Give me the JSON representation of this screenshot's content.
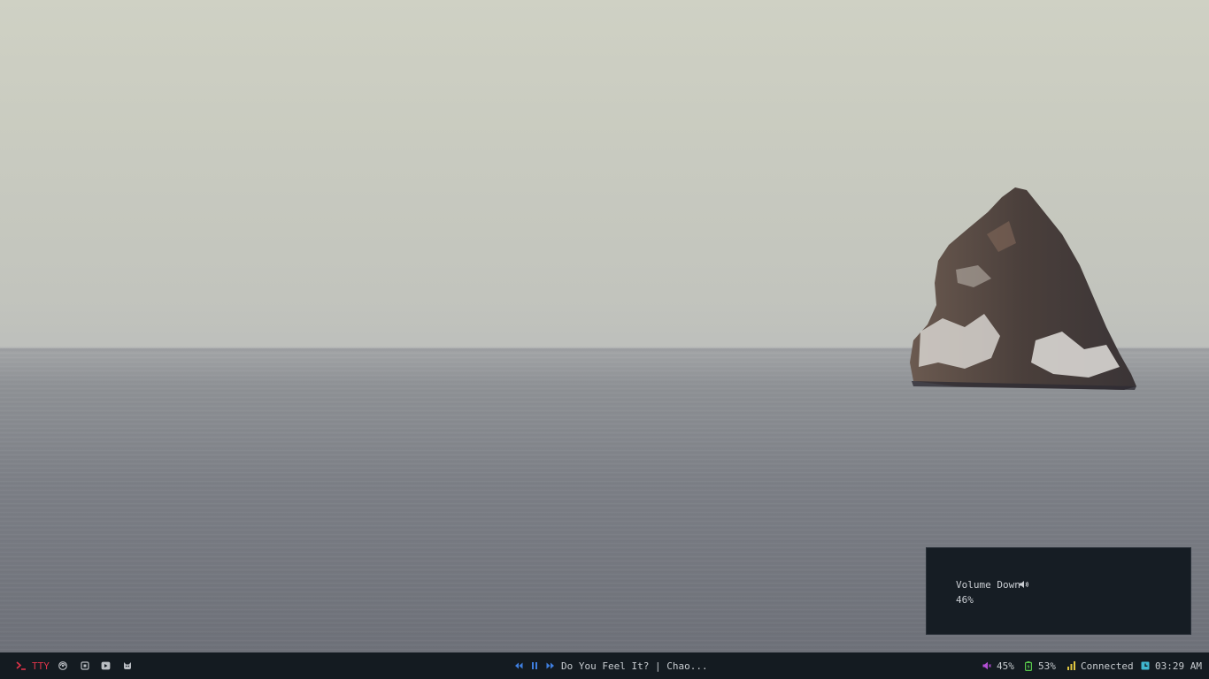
{
  "notification": {
    "title": "Volume Down",
    "value": "46%",
    "icon": "speaker-icon"
  },
  "bar": {
    "left": {
      "tty_icon": "terminal-prompt-icon",
      "tty_label": "TTY",
      "apps": [
        {
          "icon": "browser-icon"
        },
        {
          "icon": "files-icon"
        },
        {
          "icon": "media-player-icon"
        },
        {
          "icon": "cat-icon"
        }
      ]
    },
    "media": {
      "prev_icon": "rewind-icon",
      "play_icon": "pause-icon",
      "next_icon": "fast-forward-icon",
      "track": "Do You Feel It? | Chao..."
    },
    "status": {
      "volume": "45%",
      "battery": "53%",
      "network": "Connected",
      "clock": "03:29 AM"
    },
    "colors": {
      "tty": "#e0344a",
      "media": "#3f7fe0",
      "volume": "#b44fd6",
      "battery": "#57c94a",
      "network": "#e0c640",
      "clock": "#3fb6d0"
    }
  }
}
